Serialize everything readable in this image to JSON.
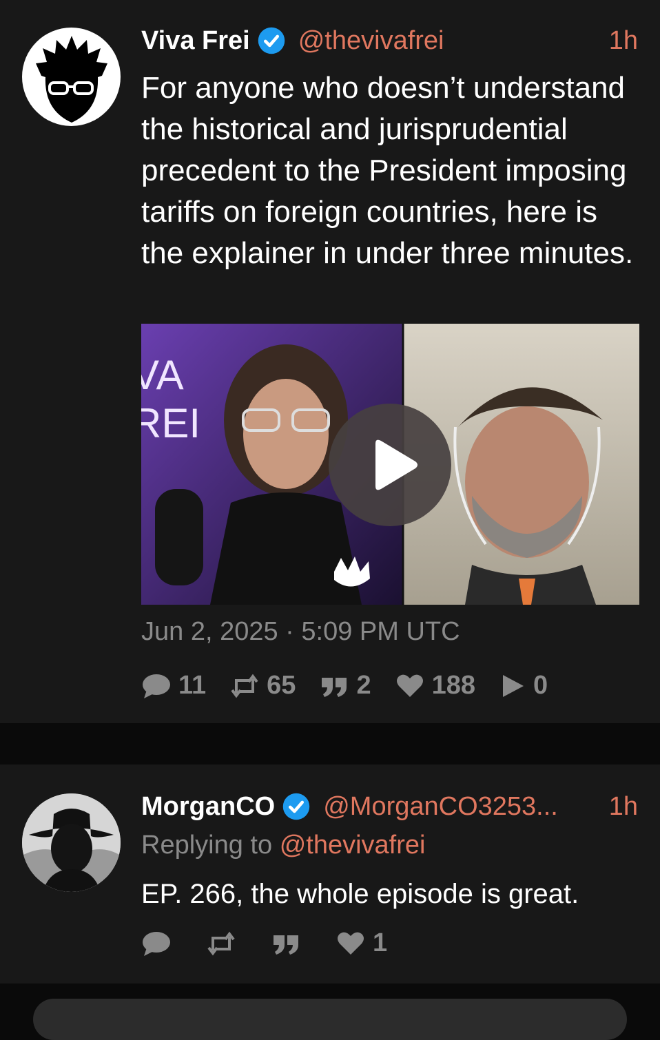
{
  "colors": {
    "background": "#181818",
    "accent": "#e0775f",
    "muted": "#8a8a8a",
    "verified": "#1d9bf0"
  },
  "tweet": {
    "author_name": "Viva Frei",
    "handle": "@thevivafrei",
    "time": "1h",
    "text": "For anyone who doesn’t understand the historical and jurisprudential precedent to the President imposing tariffs on foreign countries, here is the explainer in under three minutes.",
    "media_overlay_text": "VA\nREI",
    "date": "Jun 2, 2025 · 5:09 PM UTC",
    "stats": {
      "comments": "11",
      "retweets": "65",
      "quotes": "2",
      "likes": "188",
      "plays": "0"
    },
    "icons": [
      "verified-icon",
      "play-icon",
      "comment-icon",
      "retweet-icon",
      "quote-icon",
      "heart-icon",
      "video-play-icon"
    ]
  },
  "reply": {
    "author_name": "MorganCO",
    "handle": "@MorganCO3253...",
    "time": "1h",
    "replying_label": "Replying to",
    "replying_to": "@thevivafrei",
    "text": "EP. 266, the whole episode is great.",
    "stats": {
      "likes": "1"
    }
  }
}
